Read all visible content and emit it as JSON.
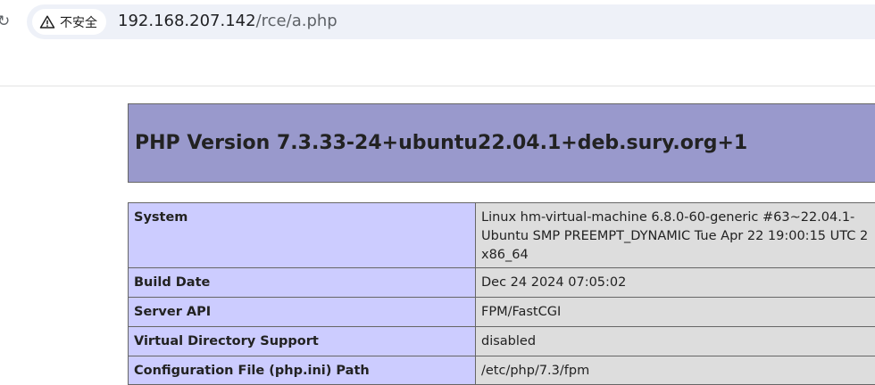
{
  "browser": {
    "security_label": "不安全",
    "url_host": "192.168.207.142",
    "url_path": "/rce/a.php"
  },
  "phpinfo": {
    "title": "PHP Version 7.3.33-24+ubuntu22.04.1+deb.sury.org+1",
    "rows": [
      {
        "key": "System",
        "value": "Linux hm-virtual-machine 6.8.0-60-generic #63~22.04.1-Ubuntu SMP PREEMPT_DYNAMIC Tue Apr 22 19:00:15 UTC 2 x86_64"
      },
      {
        "key": "Build Date",
        "value": "Dec 24 2024 07:05:02"
      },
      {
        "key": "Server API",
        "value": "FPM/FastCGI"
      },
      {
        "key": "Virtual Directory Support",
        "value": "disabled"
      },
      {
        "key": "Configuration File (php.ini) Path",
        "value": "/etc/php/7.3/fpm"
      }
    ]
  },
  "colors": {
    "header_bg": "#9999cc",
    "key_bg": "#ccccff",
    "value_bg": "#dddddd"
  }
}
